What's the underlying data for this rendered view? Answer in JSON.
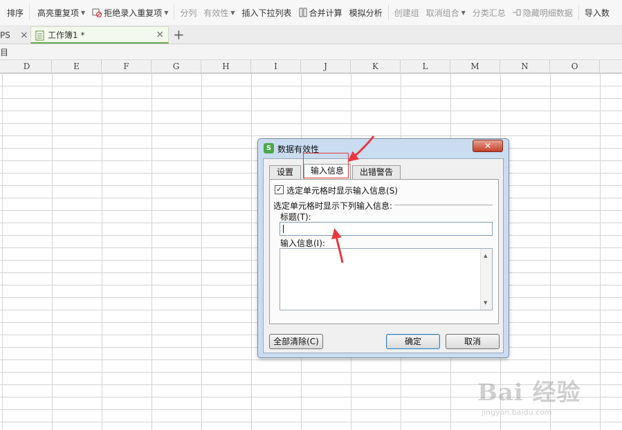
{
  "toolbar": {
    "items": [
      {
        "label": "排序",
        "dim": false
      },
      {
        "label": "高亮重复项",
        "caret": true
      },
      {
        "label": "拒绝录入重复项",
        "caret": true,
        "icon": "block-icon"
      },
      {
        "label": "分列",
        "dim": true
      },
      {
        "label": "有效性",
        "dim": true,
        "caret": true
      },
      {
        "label": "插入下拉列表",
        "dim": false
      },
      {
        "label": "合并计算",
        "icon": "merge-icon"
      },
      {
        "label": "模拟分析"
      },
      {
        "label": "创建组",
        "dim": true
      },
      {
        "label": "取消组合",
        "dim": true,
        "caret": true
      },
      {
        "label": "分类汇总",
        "dim": true
      },
      {
        "label": "隐藏明细数据",
        "dim": true,
        "icon": "hide-detail-icon"
      },
      {
        "label": "导入数"
      }
    ]
  },
  "tabs": {
    "first_label": "PS",
    "active_label": "工作簿1 *",
    "close_glyph": "×",
    "add_glyph": "+"
  },
  "formula_bar": {
    "label": "目"
  },
  "columns": [
    "D",
    "E",
    "F",
    "G",
    "H",
    "I",
    "J",
    "K",
    "L",
    "M",
    "N",
    "O"
  ],
  "dialog": {
    "title": "数据有效性",
    "close_glyph": "✕",
    "app_icon_letter": "S",
    "tabs": [
      "设置",
      "输入信息",
      "出错警告"
    ],
    "selected_tab": 1,
    "checkbox_label": "选定单元格时显示输入信息(S)",
    "checkbox_checked": true,
    "checkmark": "✓",
    "group_label": "选定单元格时显示下列输入信息:",
    "title_field_label": "标题(T):",
    "title_value": "",
    "message_label": "输入信息(I):",
    "buttons": {
      "clear_all": "全部清除(C)",
      "ok": "确定",
      "cancel": "取消"
    }
  },
  "watermark": {
    "main": "Bai 经验",
    "sub": "jingyan.baidu.com"
  },
  "colors": {
    "highlight": "#e8383d",
    "accent": "#6aa84f"
  }
}
